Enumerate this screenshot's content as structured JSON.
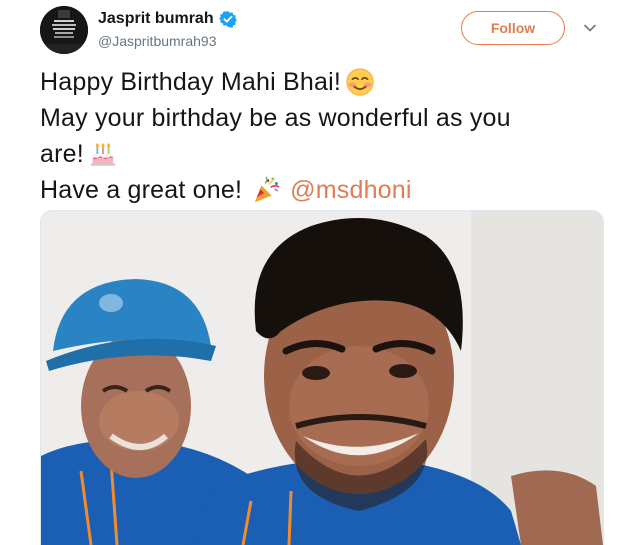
{
  "author": {
    "display_name": "Jasprit bumrah",
    "handle": "@Jaspritbumrah93",
    "verified": true,
    "avatar_icon": "profile-avatar"
  },
  "actions": {
    "follow_label": "Follow",
    "caret_icon": "chevron-down-icon"
  },
  "tweet": {
    "line1": "Happy Birthday Mahi Bhai!",
    "line1_emoji": "smiling-face-emoji",
    "line2": "May your birthday be as wonderful as you",
    "line3": "are!",
    "line3_emoji": "birthday-cake-emoji",
    "line4": "Have a great one!",
    "line4_emoji": "party-popper-emoji",
    "mention": "@msdhoni"
  },
  "media": {
    "type": "photo",
    "subject_icon": "selfie-photo"
  },
  "colors": {
    "accent": "#e07b53",
    "verified": "#1da1f2",
    "text": "#14171a",
    "muted": "#657786"
  }
}
